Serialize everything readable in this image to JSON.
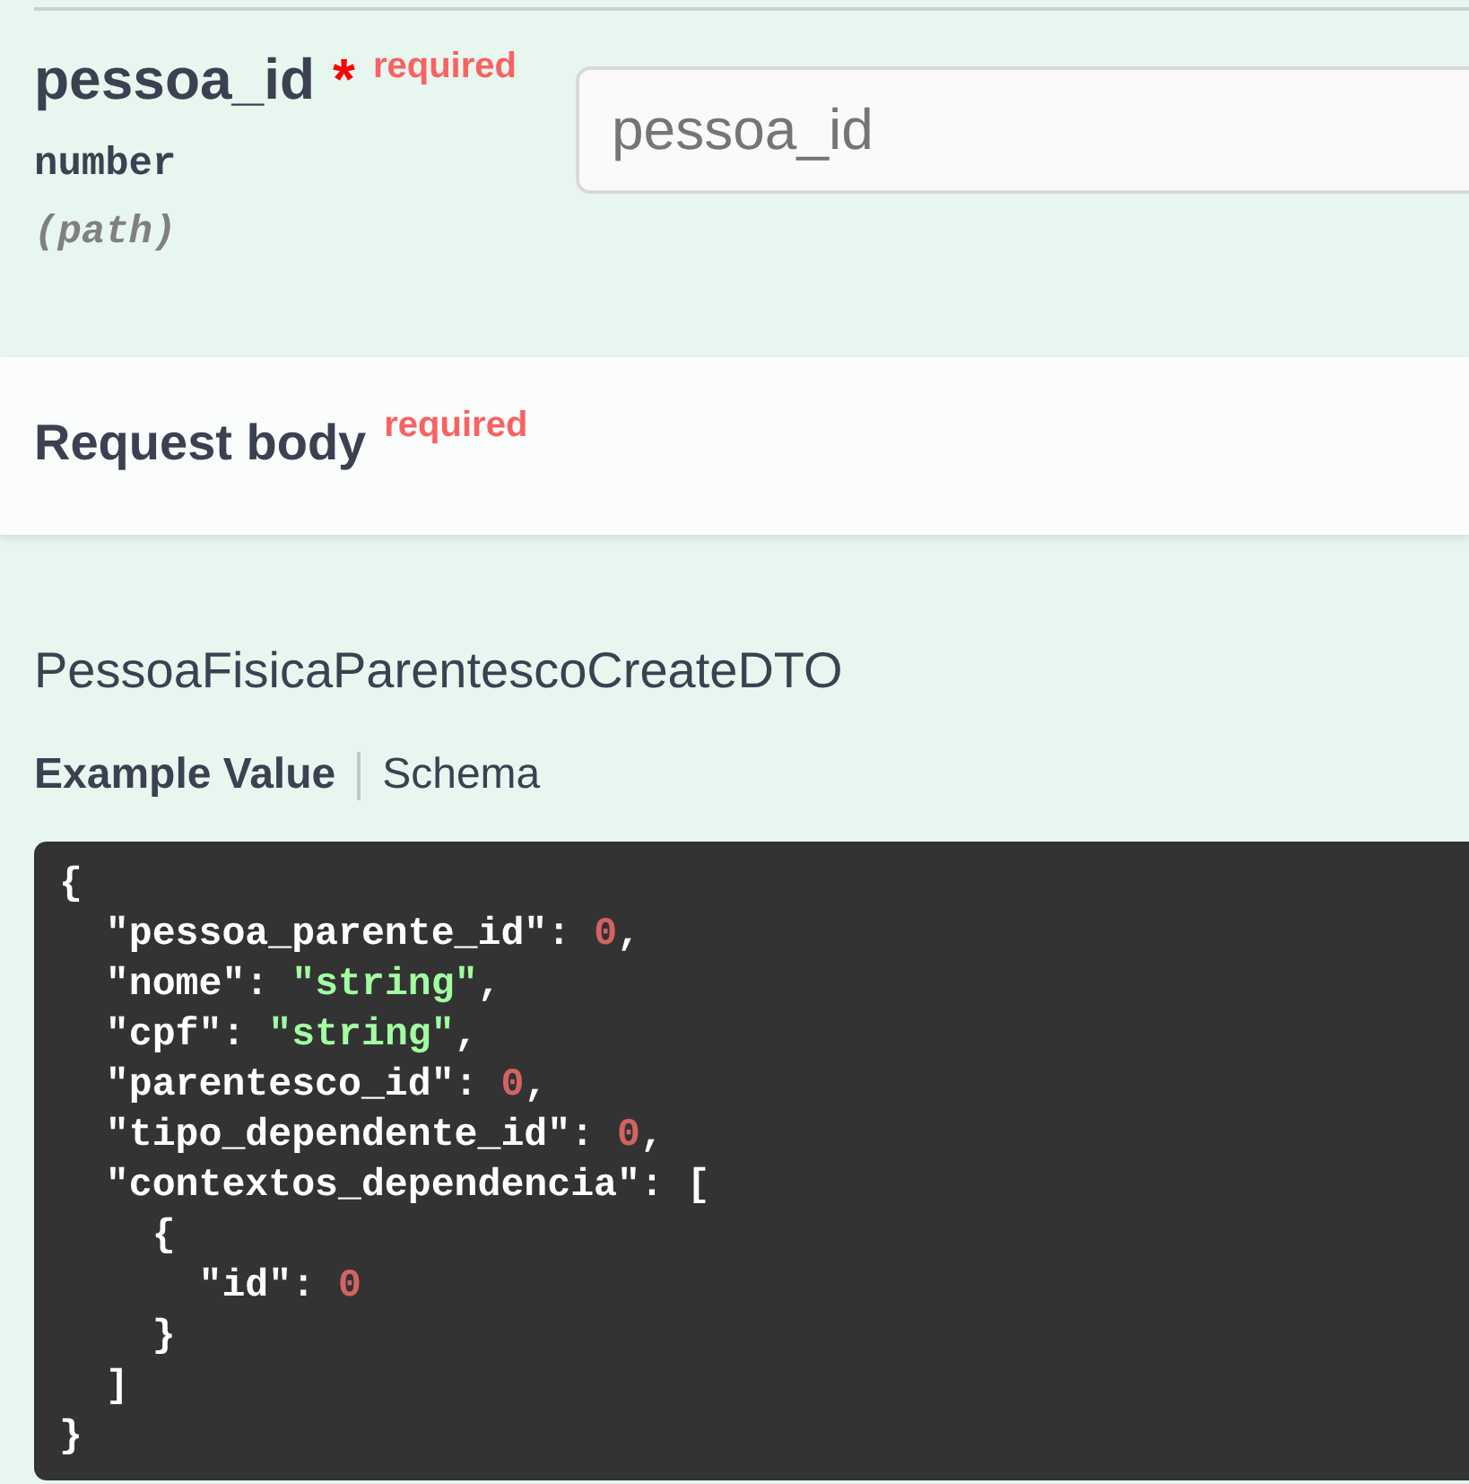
{
  "parameters": [
    {
      "name": "pessoa_id",
      "required_mark": "*",
      "required_label": "required",
      "type": "number",
      "location": "(path)",
      "input": {
        "placeholder": "pessoa_id"
      }
    }
  ],
  "request_body": {
    "title": "Request body",
    "required_label": "required",
    "model_name": "PessoaFisicaParentescoCreateDTO",
    "tabs": [
      {
        "label": "Example Value",
        "selected": true
      },
      {
        "label": "Schema",
        "selected": false
      }
    ],
    "example_value": {
      "lines": [
        "{",
        "  \"pessoa_parente_id\": 0,",
        "  \"nome\": \"string\",",
        "  \"cpf\": \"string\",",
        "  \"parentesco_id\": 0,",
        "  \"tipo_dependente_id\": 0,",
        "  \"contextos_dependencia\": [",
        "    {",
        "      \"id\": 0",
        "    }",
        "  ]",
        "}"
      ]
    }
  }
}
